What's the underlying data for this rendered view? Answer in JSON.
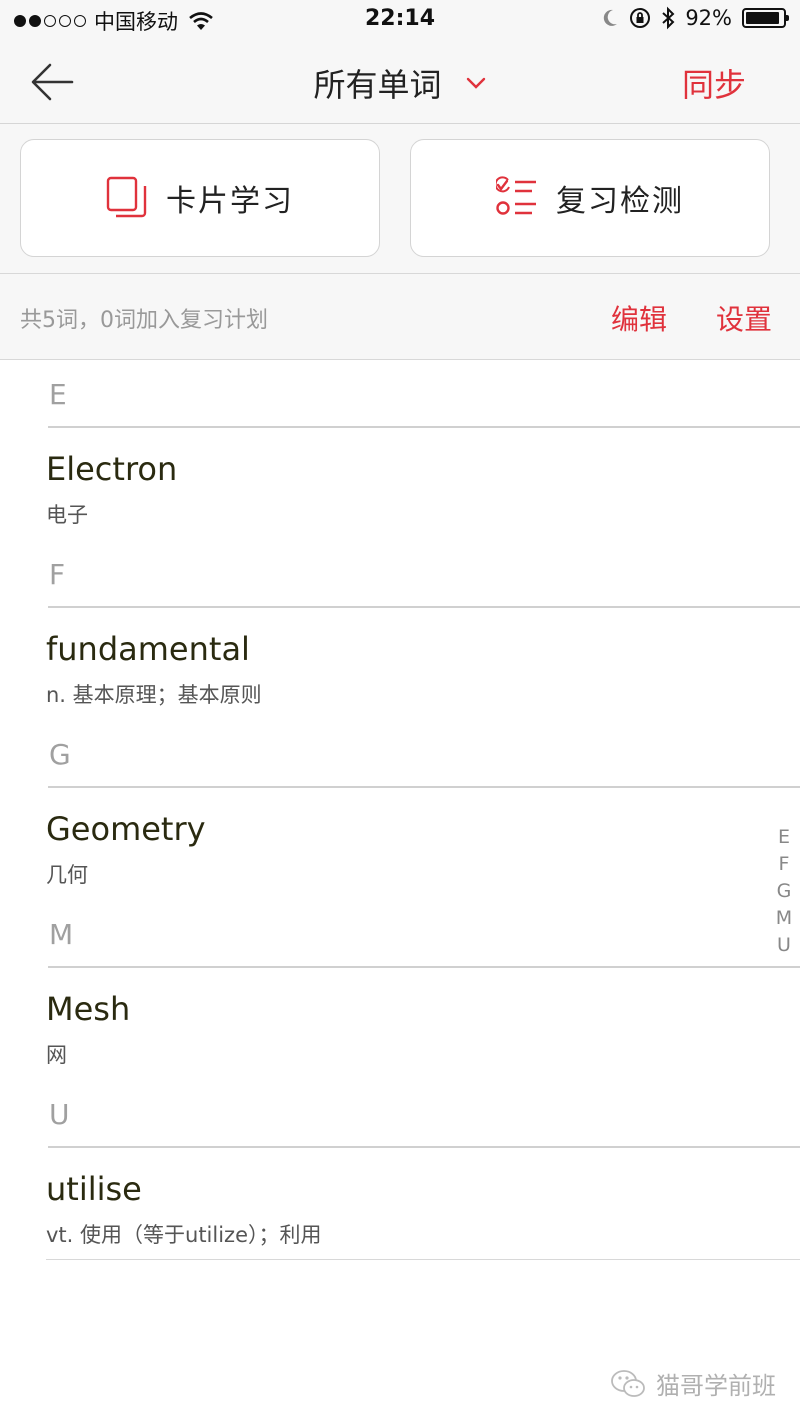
{
  "status_bar": {
    "carrier": "中国移动",
    "time": "22:14",
    "battery": "92%",
    "battery_level": 0.92,
    "signal_full": 2,
    "signal_total": 5
  },
  "nav": {
    "title": "所有单词",
    "sync_label": "同步"
  },
  "modes": {
    "card_study_label": "卡片学习",
    "review_test_label": "复习检测"
  },
  "info": {
    "summary": "共5词，0词加入复习计划",
    "edit_label": "编辑",
    "settings_label": "设置"
  },
  "sections": [
    {
      "letter": "E",
      "words": [
        {
          "word": "Electron",
          "definition": "电子"
        }
      ]
    },
    {
      "letter": "F",
      "words": [
        {
          "word": "fundamental",
          "definition": "n. 基本原理；基本原则"
        }
      ]
    },
    {
      "letter": "G",
      "words": [
        {
          "word": "Geometry",
          "definition": "几何"
        }
      ]
    },
    {
      "letter": "M",
      "words": [
        {
          "word": "Mesh",
          "definition": "网"
        }
      ]
    },
    {
      "letter": "U",
      "words": [
        {
          "word": "utilise",
          "definition": "vt. 使用（等于utilize）；利用"
        }
      ]
    }
  ],
  "index": [
    "E",
    "F",
    "G",
    "M",
    "U"
  ],
  "watermark": "猫哥学前班",
  "colors": {
    "accent": "#e0323c",
    "background": "#f7f7f7",
    "divider": "#d0d0d0"
  }
}
